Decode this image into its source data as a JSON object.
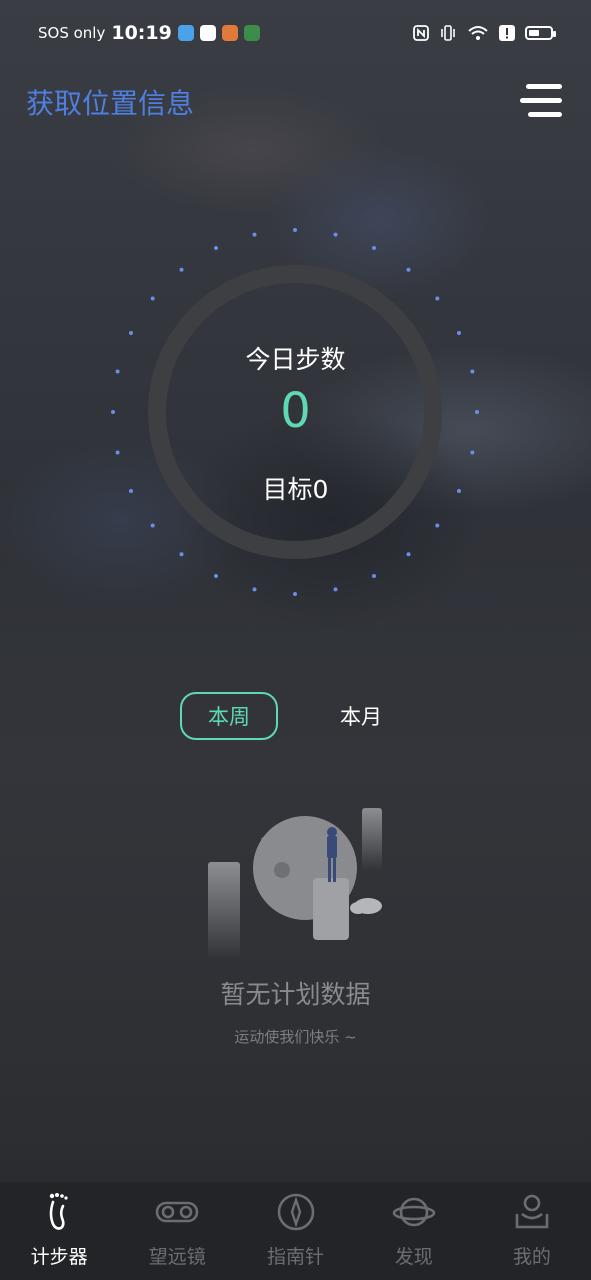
{
  "status_bar": {
    "carrier": "SOS only",
    "time": "10:19"
  },
  "header": {
    "title": "获取位置信息"
  },
  "dashboard": {
    "steps_label": "今日步数",
    "steps_value": "0",
    "goal_label": "目标0"
  },
  "period_tabs": [
    {
      "label": "本周",
      "active": true
    },
    {
      "label": "本月",
      "active": false
    }
  ],
  "empty_state": {
    "title": "暂无计划数据",
    "subtitle": "运动使我们快乐 ~"
  },
  "bottom_nav": [
    {
      "label": "计步器",
      "icon": "footprint-icon",
      "active": true
    },
    {
      "label": "望远镜",
      "icon": "binoculars-icon",
      "active": false
    },
    {
      "label": "指南针",
      "icon": "compass-icon",
      "active": false
    },
    {
      "label": "发现",
      "icon": "planet-icon",
      "active": false
    },
    {
      "label": "我的",
      "icon": "profile-icon",
      "active": false
    }
  ],
  "colors": {
    "accent": "#5ed9b3",
    "title_blue": "#4f7fe0",
    "dot_blue": "#6a8ee8"
  }
}
